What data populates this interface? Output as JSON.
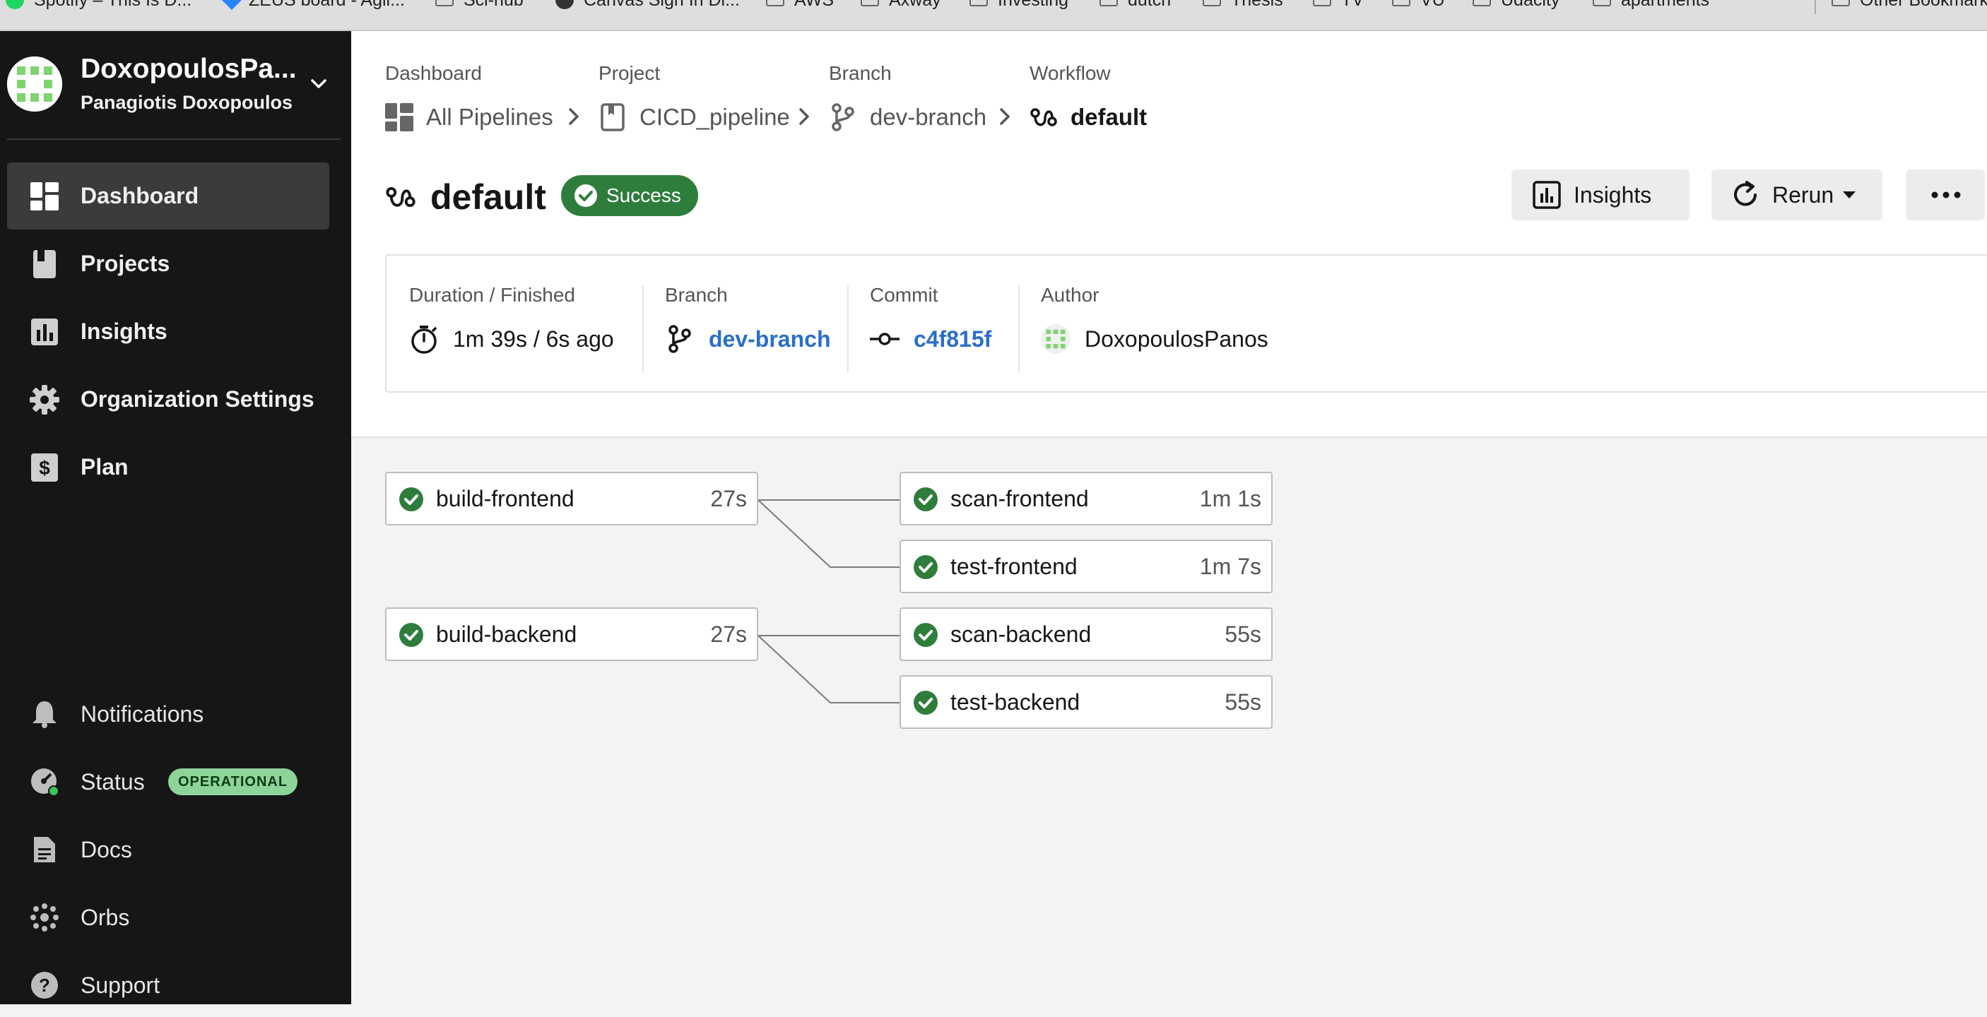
{
  "bookmarks": [
    {
      "label": "Spotify – This Is D...",
      "icon": "spotify-icon"
    },
    {
      "label": "ZEUS board - Agil...",
      "icon": "jira-icon"
    },
    {
      "label": "Sci-hub",
      "icon": "folder-icon"
    },
    {
      "label": "Canvas Sign In Di...",
      "icon": "globe-icon"
    },
    {
      "label": "AWS",
      "icon": "folder-icon"
    },
    {
      "label": "Axway",
      "icon": "folder-icon"
    },
    {
      "label": "Investing",
      "icon": "folder-icon"
    },
    {
      "label": "dutch",
      "icon": "folder-icon"
    },
    {
      "label": "Thesis",
      "icon": "folder-icon"
    },
    {
      "label": "TV",
      "icon": "folder-icon"
    },
    {
      "label": "VU",
      "icon": "folder-icon"
    },
    {
      "label": "Udacity",
      "icon": "folder-icon"
    },
    {
      "label": "apartments",
      "icon": "folder-icon"
    },
    {
      "label": "Other Bookmarks",
      "icon": "folder-icon"
    }
  ],
  "sidebar": {
    "org_name": "DoxopoulosPa...",
    "user_name": "Panagiotis Doxopoulos",
    "nav": [
      {
        "label": "Dashboard",
        "icon": "dashboard-icon",
        "active": true
      },
      {
        "label": "Projects",
        "icon": "projects-icon"
      },
      {
        "label": "Insights",
        "icon": "insights-icon"
      },
      {
        "label": "Organization Settings",
        "icon": "gear-icon"
      },
      {
        "label": "Plan",
        "icon": "dollar-icon"
      }
    ],
    "bottom": [
      {
        "label": "Notifications",
        "icon": "bell-icon"
      },
      {
        "label": "Status",
        "icon": "status-icon",
        "badge": "OPERATIONAL"
      },
      {
        "label": "Docs",
        "icon": "docs-icon"
      },
      {
        "label": "Orbs",
        "icon": "orbs-icon"
      },
      {
        "label": "Support",
        "icon": "help-icon"
      }
    ]
  },
  "breadcrumbs": [
    {
      "label": "Dashboard",
      "value": "All Pipelines",
      "icon": "dashboard-icon"
    },
    {
      "label": "Project",
      "value": "CICD_pipeline",
      "icon": "project-book-icon"
    },
    {
      "label": "Branch",
      "value": "dev-branch",
      "icon": "git-branch-icon"
    },
    {
      "label": "Workflow",
      "value": "default",
      "icon": "workflow-icon"
    }
  ],
  "workflow": {
    "title": "default",
    "status": "Success",
    "status_color": "#2f7d3c"
  },
  "buttons": {
    "insights": "Insights",
    "rerun": "Rerun"
  },
  "meta": {
    "duration_label": "Duration / Finished",
    "duration_value": "1m 39s / 6s ago",
    "branch_label": "Branch",
    "branch_value": "dev-branch",
    "commit_label": "Commit",
    "commit_value": "c4f815f",
    "author_label": "Author",
    "author_value": "DoxopoulosPanos"
  },
  "jobs": [
    {
      "name": "build-frontend",
      "duration": "27s",
      "status": "success"
    },
    {
      "name": "scan-frontend",
      "duration": "1m 1s",
      "status": "success"
    },
    {
      "name": "test-frontend",
      "duration": "1m 7s",
      "status": "success"
    },
    {
      "name": "build-backend",
      "duration": "27s",
      "status": "success"
    },
    {
      "name": "scan-backend",
      "duration": "55s",
      "status": "success"
    },
    {
      "name": "test-backend",
      "duration": "55s",
      "status": "success"
    }
  ],
  "colors": {
    "sidebar_bg": "#161616",
    "success": "#2f7d3c",
    "link": "#2a6fc9",
    "operational_badge": "#8ed499"
  }
}
